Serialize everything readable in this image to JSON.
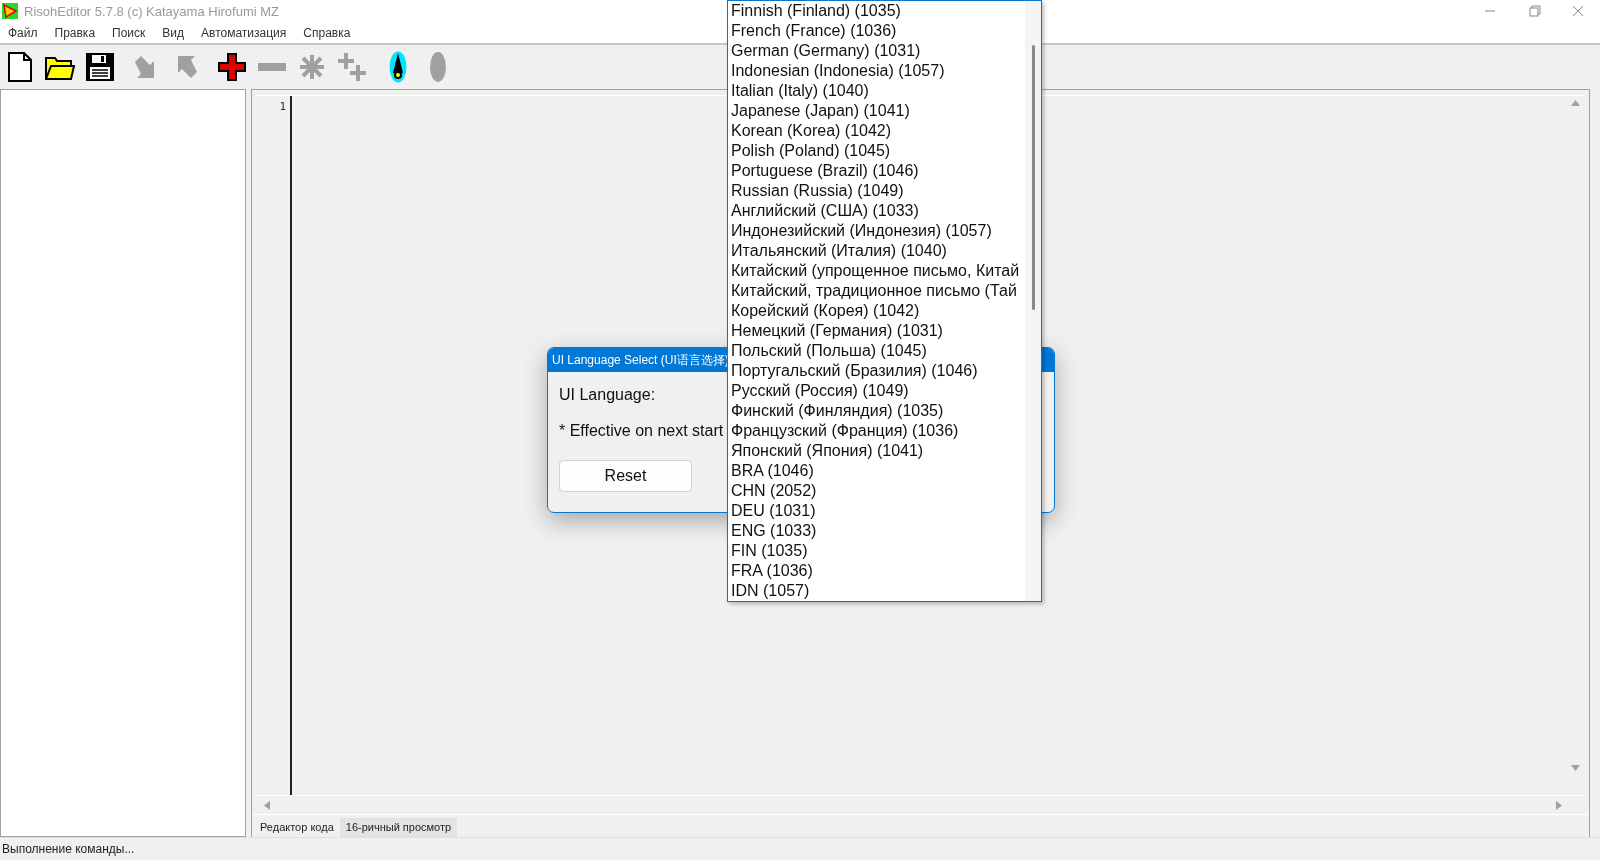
{
  "window": {
    "title": "RisohEditor 5.7.8 (c) Katayama Hirofumi MZ"
  },
  "menu": [
    "Файл",
    "Правка",
    "Поиск",
    "Вид",
    "Автоматизация",
    "Справка"
  ],
  "toolbar": [
    {
      "kind": "new",
      "disabled": false
    },
    {
      "kind": "open",
      "disabled": false
    },
    {
      "kind": "save",
      "disabled": false
    },
    {
      "kind": "down",
      "disabled": true
    },
    {
      "kind": "up",
      "disabled": true
    },
    {
      "kind": "plus",
      "disabled": false
    },
    {
      "kind": "minus",
      "disabled": true
    },
    {
      "kind": "star",
      "disabled": true
    },
    {
      "kind": "plusplus",
      "disabled": true
    },
    {
      "kind": "compass",
      "disabled": false
    },
    {
      "kind": "ellipse",
      "disabled": true
    }
  ],
  "editor": {
    "line_numbers": [
      "1"
    ]
  },
  "tabs": [
    {
      "label": "Редактор кода",
      "selected": true
    },
    {
      "label": "16-ричный просмотр",
      "selected": false
    }
  ],
  "status_bar": "Выполнение команды...",
  "dialog": {
    "title": "UI Language Select (UI语言选择)",
    "label": "UI Language:",
    "note": "* Effective on next start",
    "button": "Reset"
  },
  "dropdown": {
    "items": [
      "Finnish (Finland) (1035)",
      "French (France) (1036)",
      "German (Germany) (1031)",
      "Indonesian (Indonesia) (1057)",
      "Italian (Italy) (1040)",
      "Japanese (Japan) (1041)",
      "Korean (Korea) (1042)",
      "Polish (Poland) (1045)",
      "Portuguese (Brazil) (1046)",
      "Russian (Russia) (1049)",
      "Английский (США) (1033)",
      "Индонезийский (Индонезия) (1057)",
      "Итальянский (Италия) (1040)",
      "Китайский (упрощенное письмо, Китай",
      "Китайский, традиционное письмо (Тай",
      "Корейский (Корея) (1042)",
      "Немецкий (Германия) (1031)",
      "Польский (Польша) (1045)",
      "Португальский (Бразилия) (1046)",
      "Русский (Россия) (1049)",
      "Финский (Финляндия) (1035)",
      "Французский (Франция) (1036)",
      "Японский (Япония) (1041)",
      "BRA (1046)",
      "CHN (2052)",
      "DEU (1031)",
      "ENG (1033)",
      "FIN (1035)",
      "FRA (1036)",
      "IDN (1057)"
    ]
  }
}
